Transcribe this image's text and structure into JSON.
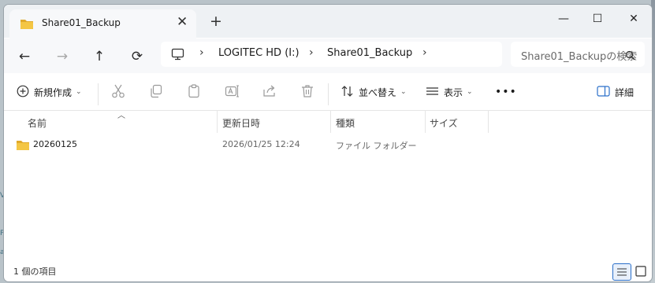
{
  "tab": {
    "title": "Share01_Backup",
    "close": "✕",
    "new": "+"
  },
  "window_controls": {
    "minimize": "—",
    "maximize": "☐",
    "close": "✕"
  },
  "nav": {
    "back": "←",
    "forward": "→",
    "up": "↑",
    "refresh": "⟳"
  },
  "address": {
    "separator": "›",
    "crumbs": [
      "LOGITEC HD (I:)",
      "Share01_Backup"
    ]
  },
  "search": {
    "placeholder": "Share01_Backupの検索"
  },
  "toolbar": {
    "new_label": "新規作成",
    "sort_label": "並べ替え",
    "view_label": "表示",
    "more_label": "•••",
    "details_label": "詳細",
    "chevron": "⌄"
  },
  "columns": {
    "name": "名前",
    "modified": "更新日時",
    "type": "種類",
    "size": "サイズ"
  },
  "files": [
    {
      "name": "20260125",
      "modified": "2026/01/25 12:24",
      "type": "ファイル フォルダー",
      "size": ""
    }
  ],
  "status": {
    "item_count": "1 個の項目"
  },
  "colors": {
    "accent": "#2a6fc9",
    "folder": "#f4c644",
    "folder_dark": "#e0a92a"
  }
}
